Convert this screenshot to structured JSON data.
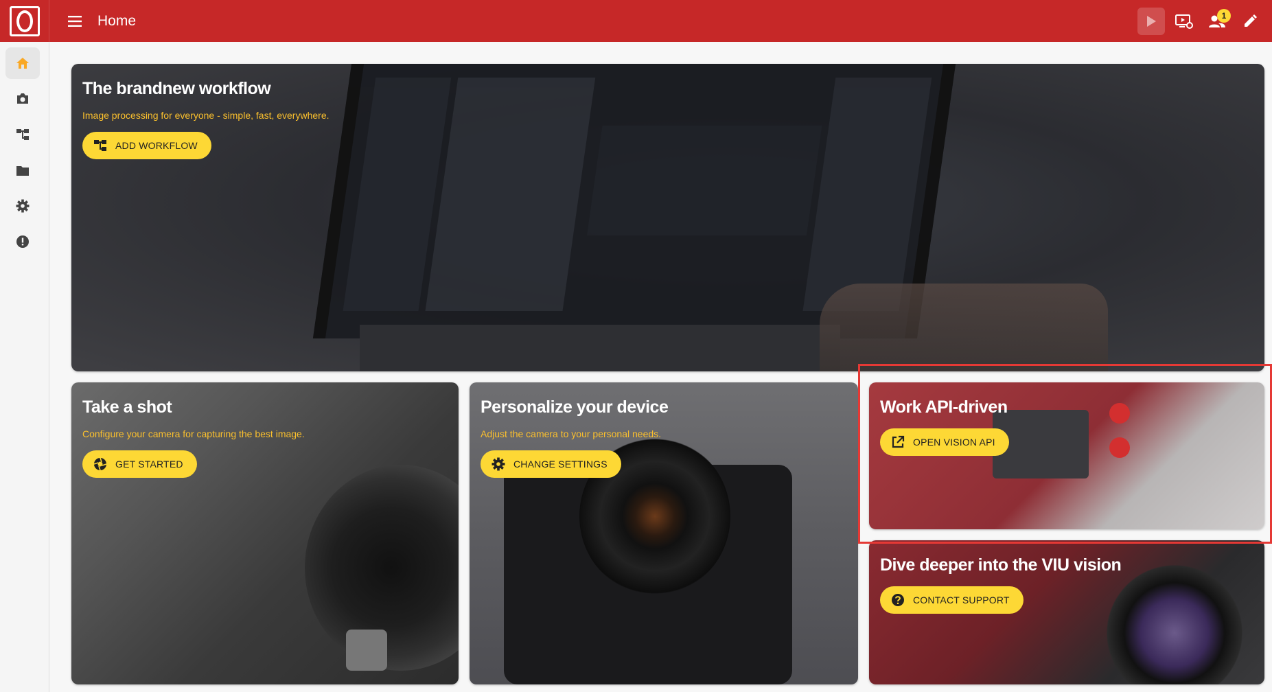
{
  "appbar": {
    "title": "Home",
    "notification_count": "1"
  },
  "hero": {
    "title": "The brandnew workflow",
    "subtitle": "Image processing for everyone - simple, fast, everywhere.",
    "button": "ADD WORKFLOW"
  },
  "cards": {
    "shot": {
      "title": "Take a shot",
      "subtitle": "Configure your camera for capturing the best image.",
      "button": "GET STARTED"
    },
    "device": {
      "title": "Personalize your device",
      "subtitle": "Adjust the camera to your personal needs.",
      "button": "CHANGE SETTINGS"
    },
    "api": {
      "title": "Work API-driven",
      "button": "OPEN VISION API"
    },
    "dive": {
      "title": "Dive deeper into the VIU vision",
      "button": "CONTACT SUPPORT"
    }
  },
  "icons": {
    "sidebar": [
      "home-icon",
      "camera-icon",
      "workflow-icon",
      "folder-icon",
      "settings-icon",
      "info-icon"
    ],
    "appbar": [
      "menu-icon",
      "play-icon",
      "monitor-settings-icon",
      "users-icon",
      "edit-icon"
    ]
  },
  "colors": {
    "appbar": "#c62828",
    "accent": "#fdd835",
    "subtitle": "#fbc02d",
    "highlight": "#e53935"
  }
}
